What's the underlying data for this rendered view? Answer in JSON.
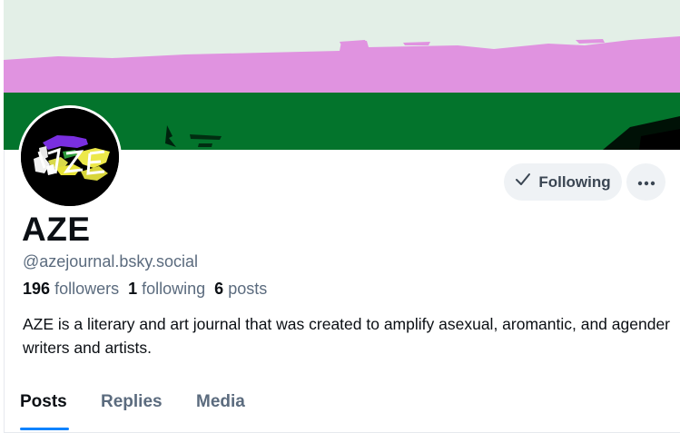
{
  "profile": {
    "display_name": "AZE",
    "handle": "@azejournal.bsky.social",
    "bio": "AZE is a literary and art journal that was created to amplify asexual, aromantic, and agender writers and artists.",
    "avatar_text": "AZE"
  },
  "stats": {
    "followers_count": "196",
    "followers_label": "followers",
    "following_count": "1",
    "following_label": "following",
    "posts_count": "6",
    "posts_label": "posts"
  },
  "actions": {
    "following_label": "Following",
    "more_icon": "ellipsis-icon",
    "check_icon": "check-icon"
  },
  "tabs": [
    {
      "label": "Posts",
      "active": true
    },
    {
      "label": "Replies",
      "active": false
    },
    {
      "label": "Media",
      "active": false
    }
  ],
  "colors": {
    "banner_top": "#e3efe7",
    "banner_pink": "#e093e0",
    "banner_green": "#03742c",
    "accent": "#1083fe",
    "button_bg": "#eff2f5",
    "muted_text": "#5b6b7e"
  }
}
